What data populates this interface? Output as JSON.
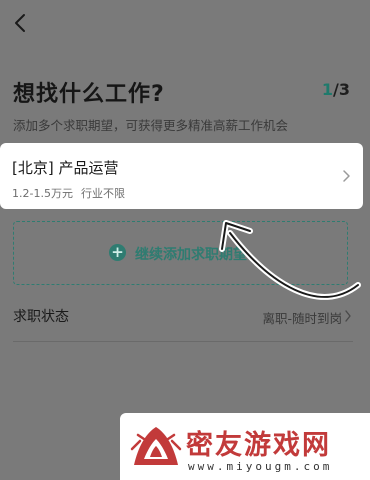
{
  "nav": {
    "back_icon": "chevron-left-icon"
  },
  "header": {
    "title": "想找什么工作?",
    "step_current": "1",
    "step_total": "/3",
    "subtitle": "添加多个求职期望，可获得更多精准高薪工作机会"
  },
  "expectation_card": {
    "title": "[北京] 产品运营",
    "salary": "1.2-1.5万元",
    "industry": "行业不限",
    "arrow_icon": "chevron-right-icon"
  },
  "add_expectation": {
    "label": "继续添加求职期望",
    "icon": "plus-circle-icon"
  },
  "job_status": {
    "label": "求职状态",
    "value": "离职-随时到岗",
    "arrow_icon": "chevron-right-icon"
  },
  "overlay": {
    "icon": "swipe-up-arrow-icon"
  },
  "watermark": {
    "title": "密友游戏网",
    "url": "www.miyougm.com",
    "logo": "miyou-logo"
  },
  "colors": {
    "accent": "#2f7c71",
    "overlay_bg": "#7a7a7a",
    "card_bg": "#ffffff",
    "watermark_red": "#c23a3a"
  }
}
